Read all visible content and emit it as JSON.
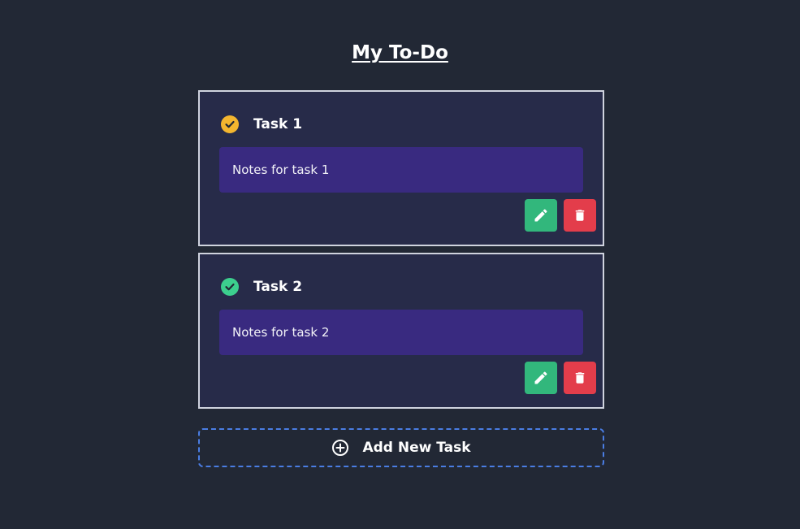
{
  "header": {
    "title": "My To-Do"
  },
  "tasks": [
    {
      "title": "Task 1",
      "notes": "Notes for task 1",
      "status_icon": "check-circle-icon",
      "status_color": "#f4b62f"
    },
    {
      "title": "Task 2",
      "notes": "Notes for task 2",
      "status_icon": "check-circle-icon",
      "status_color": "#3ccf8e"
    }
  ],
  "actions": {
    "edit_icon": "pencil-icon",
    "delete_icon": "trash-icon",
    "edit_color": "#32b77c",
    "delete_color": "#e33d4b"
  },
  "add_task": {
    "label": "Add New Task",
    "icon": "plus-circle-icon",
    "border_color": "#4a7de3"
  }
}
